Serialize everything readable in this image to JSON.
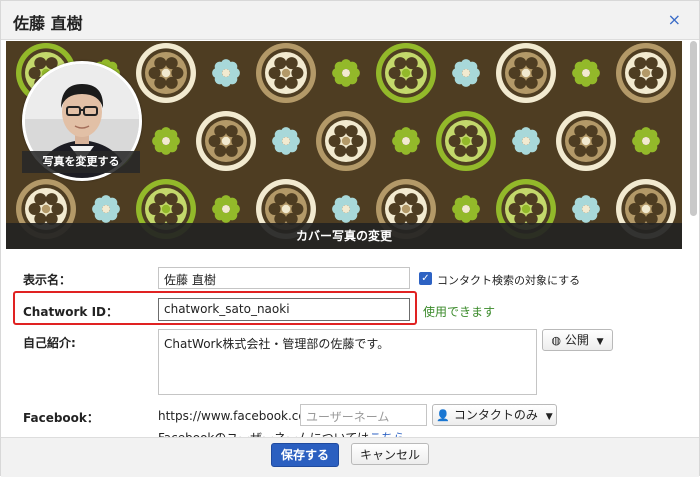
{
  "dialog": {
    "title": "佐藤 直樹",
    "close_glyph": "×"
  },
  "cover": {
    "change_cover_label": "カバー写真の変更",
    "change_photo_label": "写真を変更する",
    "pattern_colors": {
      "background": "#4e3d22",
      "lime": "#93b92a",
      "cream": "#f2ead0",
      "teal": "#a8d8d9",
      "tan": "#b39968",
      "light_green": "#c3d86b"
    }
  },
  "form": {
    "display_name": {
      "label": "表示名：",
      "value": "佐藤 直樹",
      "checkbox_label": "コンタクト検索の対象にする",
      "checkbox_checked": true
    },
    "chatwork_id": {
      "label": "Chatwork ID：",
      "value": "chatwork_sato_naoki",
      "status": "使用できます"
    },
    "bio": {
      "label": "自己紹介:",
      "value": "ChatWork株式会社・管理部の佐藤です。",
      "visibility_label": "公開",
      "visibility_icon": "globe-icon"
    },
    "facebook": {
      "label": "Facebook：",
      "url_prefix": "https://www.facebook.com/",
      "placeholder": "ユーザーネーム",
      "visibility_label": "コンタクトのみ",
      "visibility_icon": "person-icon",
      "note_text": "Facebookのユーザーネームについては",
      "note_link": "こちら"
    }
  },
  "footer": {
    "save_label": "保存する",
    "cancel_label": "キャンセル"
  },
  "colors": {
    "primary": "#2b5fc0",
    "highlight": "#e02222",
    "success": "#3a8a2a"
  }
}
